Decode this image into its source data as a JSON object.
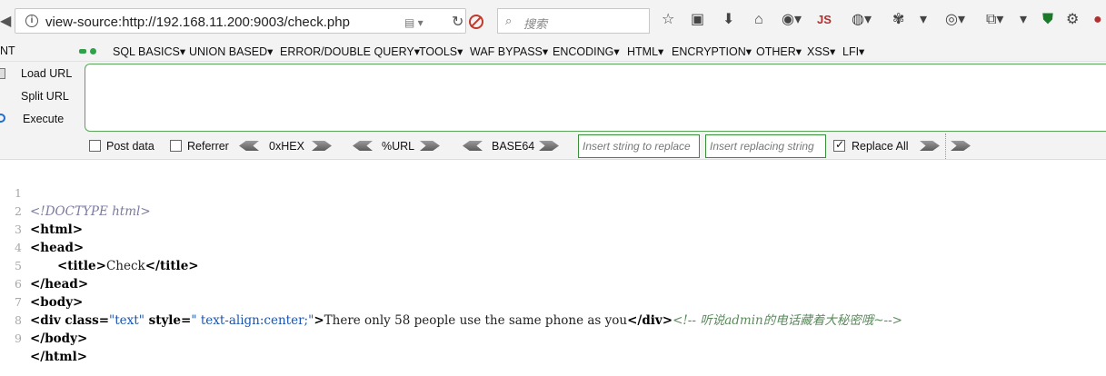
{
  "browser": {
    "url": "view-source:http://192.168.11.200:9003/check.php",
    "search_placeholder": "搜索",
    "js_label": "JS"
  },
  "hackbar": {
    "menu_partial": "NT",
    "menu": [
      "SQL BASICS▾",
      "UNION BASED▾",
      "ERROR/DOUBLE QUERY▾",
      "TOOLS▾",
      "WAF BYPASS▾",
      "ENCODING▾",
      "HTML▾",
      "ENCRYPTION▾",
      "OTHER▾",
      "XSS▾",
      "LFI▾"
    ],
    "load_url": "Load URL",
    "split_url": "Split URL",
    "execute": "Execute",
    "url_value": "",
    "post_data": "Post data",
    "referrer": "Referrer",
    "hex": "0xHEX",
    "url_enc": "%URL",
    "base64": "BASE64",
    "replace_placeholder": "Insert string to replace",
    "replacing_placeholder": "Insert replacing string",
    "replace_all": "Replace All",
    "replace_all_checked": true
  },
  "source": {
    "line_numbers": [
      "1",
      "2",
      "3",
      "4",
      "5",
      "6",
      "7",
      "8",
      "9"
    ],
    "doctype": "<!DOCTYPE html>",
    "html_open": "<html>",
    "head_open": "<head>",
    "title_open": "<title>",
    "title_text": "Check",
    "title_close": "</title>",
    "head_close": "</head>",
    "body_open": "<body>",
    "div_tag": "<div",
    "class_attr": " class=",
    "class_val": "\"text\"",
    "style_attr": " style=",
    "style_val": "\" text-align:center;\"",
    "tag_end": ">",
    "div_text": "There only 58 people use the same phone as you",
    "div_close": "</div>",
    "comment": "<!-- 听说admin的电话藏着大秘密哦~-->",
    "body_close": "</body>",
    "html_close": "</html>"
  }
}
